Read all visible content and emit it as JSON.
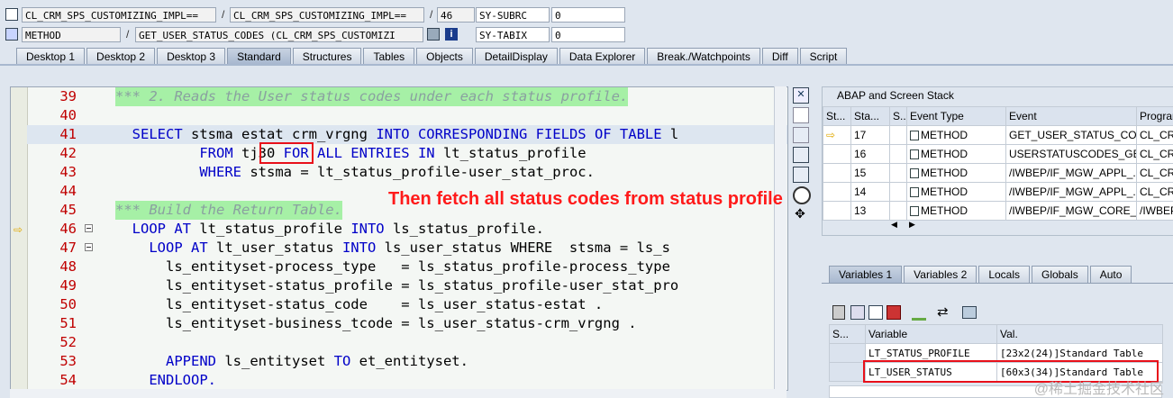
{
  "header": {
    "row1": {
      "program": "CL_CRM_SPS_CUSTOMIZING_IMPL==",
      "include": "CL_CRM_SPS_CUSTOMIZING_IMPL==",
      "line": "46",
      "var_name": "SY-SUBRC",
      "var_value": "0"
    },
    "row2": {
      "type": "METHOD",
      "method": "GET_USER_STATUS_CODES (CL_CRM_SPS_CUSTOMIZI",
      "var_name": "SY-TABIX",
      "var_value": "0"
    }
  },
  "tabs": [
    "Desktop 1",
    "Desktop 2",
    "Desktop 3",
    "Standard",
    "Structures",
    "Tables",
    "Objects",
    "DetailDisplay",
    "Data Explorer",
    "Break./Watchpoints",
    "Diff",
    "Script"
  ],
  "active_tab": "Standard",
  "code": [
    {
      "n": "39",
      "text": "*** 2. Reads the User status codes under each status profile.",
      "type": "comment"
    },
    {
      "n": "40",
      "text": "",
      "type": "plain"
    },
    {
      "n": "41",
      "pre": "  ",
      "kw1": "SELECT",
      "mid": " stsma estat crm_vrgng ",
      "kw2": "INTO CORRESPONDING FIELDS OF TABLE",
      "post": " l",
      "type": "code",
      "cur": true
    },
    {
      "n": "42",
      "pre": "          ",
      "kw1": "FROM",
      "mid": " tj30 ",
      "kw2": "FOR ALL ENTRIES IN",
      "post": " lt_status_profile",
      "type": "code"
    },
    {
      "n": "43",
      "pre": "          ",
      "kw1": "WHERE",
      "mid": " stsma = lt_status_profile-user_stat_proc.",
      "kw2": "",
      "post": "",
      "type": "code"
    },
    {
      "n": "44",
      "text": "",
      "type": "plain"
    },
    {
      "n": "45",
      "text": "*** Build the Return Table.",
      "type": "comment"
    },
    {
      "n": "46",
      "pre": "  ",
      "kw1": "LOOP AT",
      "mid": " lt_status_profile ",
      "kw2": "INTO",
      "post": " ls_status_profile.",
      "type": "code",
      "fold": true,
      "arrow": true
    },
    {
      "n": "47",
      "pre": "    ",
      "kw1": "LOOP AT",
      "mid": " lt_user_status ",
      "kw2": "INTO",
      "post": " ls_user_status WHERE  stsma = ls_s",
      "type": "code",
      "fold": true
    },
    {
      "n": "48",
      "pre": "      ",
      "kw1": "",
      "mid": "ls_entityset-process_type   = ls_status_profile-process_type",
      "kw2": "",
      "post": "",
      "type": "code"
    },
    {
      "n": "49",
      "pre": "      ",
      "kw1": "",
      "mid": "ls_entityset-status_profile = ls_status_profile-user_stat_pro",
      "kw2": "",
      "post": "",
      "type": "code"
    },
    {
      "n": "50",
      "pre": "      ",
      "kw1": "",
      "mid": "ls_entityset-status_code    = ls_user_status-estat .",
      "kw2": "",
      "post": "",
      "type": "code"
    },
    {
      "n": "51",
      "pre": "      ",
      "kw1": "",
      "mid": "ls_entityset-business_tcode = ls_user_status-crm_vrgng .",
      "kw2": "",
      "post": "",
      "type": "code"
    },
    {
      "n": "52",
      "text": "",
      "type": "plain"
    },
    {
      "n": "53",
      "pre": "      ",
      "kw1": "APPEND",
      "mid": " ls_entityset ",
      "kw2": "TO",
      "post": " et_entityset.",
      "type": "code"
    },
    {
      "n": "54",
      "pre": "    ",
      "kw1": "ENDLOOP.",
      "mid": "",
      "kw2": "",
      "post": "",
      "type": "code"
    }
  ],
  "annotation": "Then fetch all status codes from status profile",
  "stack": {
    "title": "ABAP and Screen Stack",
    "columns": [
      "St...",
      "Sta...",
      "S...",
      "Event Type",
      "Event",
      "Program"
    ],
    "rows": [
      {
        "level": "17",
        "type": "METHOD",
        "event": "GET_USER_STATUS_CO...",
        "program": "CL_CRM",
        "current": true
      },
      {
        "level": "16",
        "type": "METHOD",
        "event": "USERSTATUSCODES_GE...",
        "program": "CL_CRM"
      },
      {
        "level": "15",
        "type": "METHOD",
        "event": "/IWBEP/IF_MGW_APPL_...",
        "program": "CL_CRM"
      },
      {
        "level": "14",
        "type": "METHOD",
        "event": "/IWBEP/IF_MGW_APPL_...",
        "program": "CL_CRM"
      },
      {
        "level": "13",
        "type": "METHOD",
        "event": "/IWBEP/IF_MGW_CORE_...",
        "program": "/IWBEP"
      }
    ]
  },
  "var_tabs": [
    "Variables 1",
    "Variables 2",
    "Locals",
    "Globals",
    "Auto"
  ],
  "variables": {
    "columns": [
      "S...",
      "Variable",
      "Val."
    ],
    "rows": [
      {
        "name": "LT_STATUS_PROFILE",
        "value": "[23x2(24)]Standard Table"
      },
      {
        "name": "LT_USER_STATUS",
        "value": "[60x3(34)]Standard Table"
      }
    ]
  },
  "watermark": "@稀土掘金技术社区"
}
